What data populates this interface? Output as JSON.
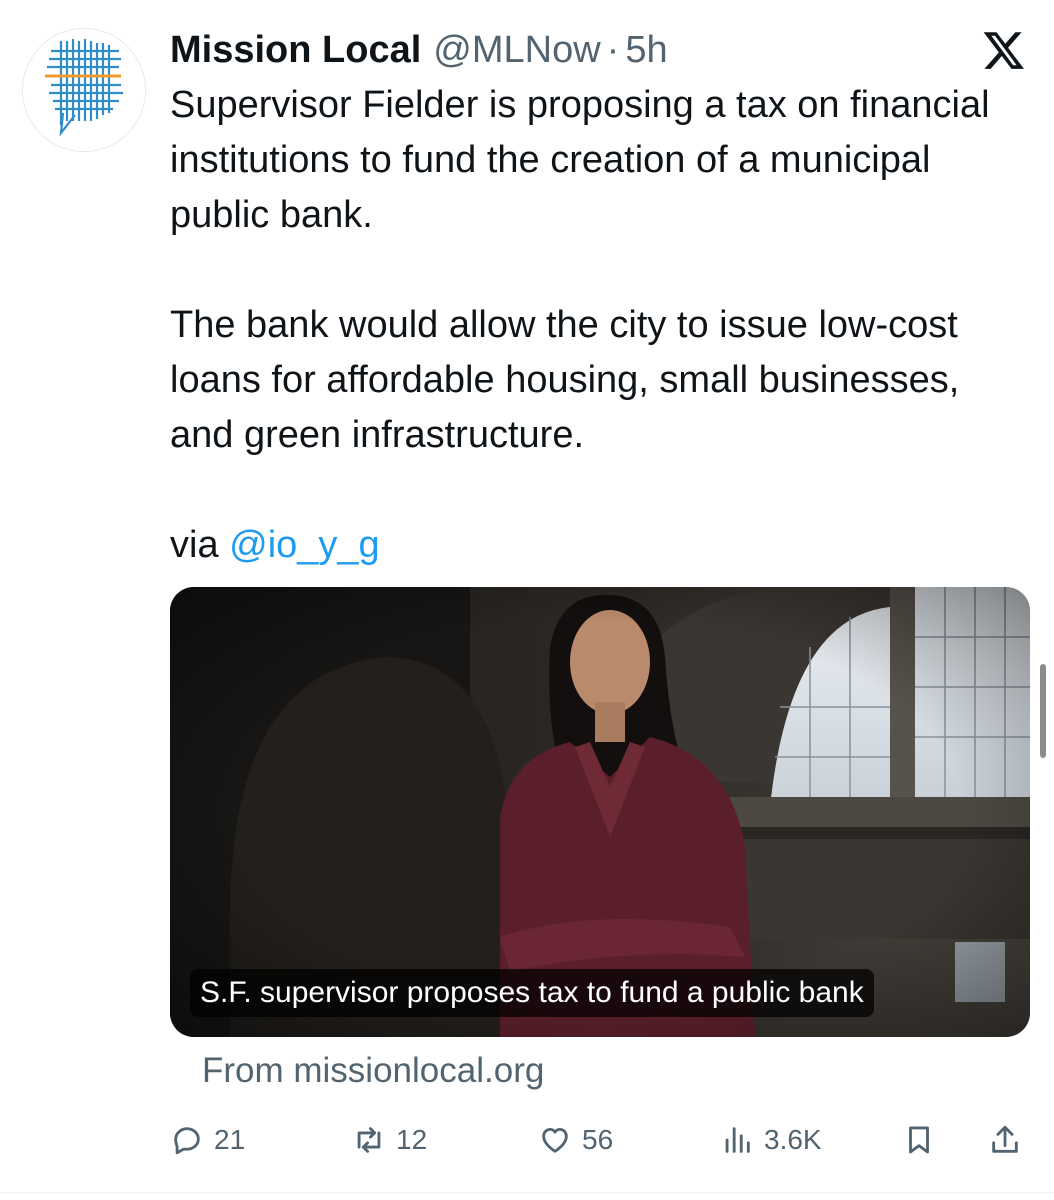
{
  "tweet": {
    "author": {
      "name": "Mission Local",
      "handle": "@MLNow",
      "separator": "·",
      "time": "5h"
    },
    "text": {
      "paragraph1": "Supervisor Fielder is proposing a tax on financial institutions to fund the creation of a municipal public bank.",
      "paragraph2": "The bank would allow the city to issue low-cost loans for affordable housing, small businesses, and green infrastructure.",
      "via_prefix": "via ",
      "mention": "@io_y_g"
    },
    "card": {
      "caption": "S.F. supervisor proposes tax to fund a public bank",
      "source": "From missionlocal.org"
    },
    "actions": {
      "replies": "21",
      "reposts": "12",
      "likes": "56",
      "views": "3.6K"
    },
    "icons": {
      "avatar": "mission-local-logo",
      "platform": "x-logo",
      "reply": "reply-icon",
      "repost": "repost-icon",
      "like": "heart-icon",
      "views": "views-icon",
      "bookmark": "bookmark-icon",
      "share": "share-icon"
    },
    "colors": {
      "link": "#1d9bf0",
      "secondary_text": "#536471",
      "primary_text": "#0f1419"
    }
  }
}
